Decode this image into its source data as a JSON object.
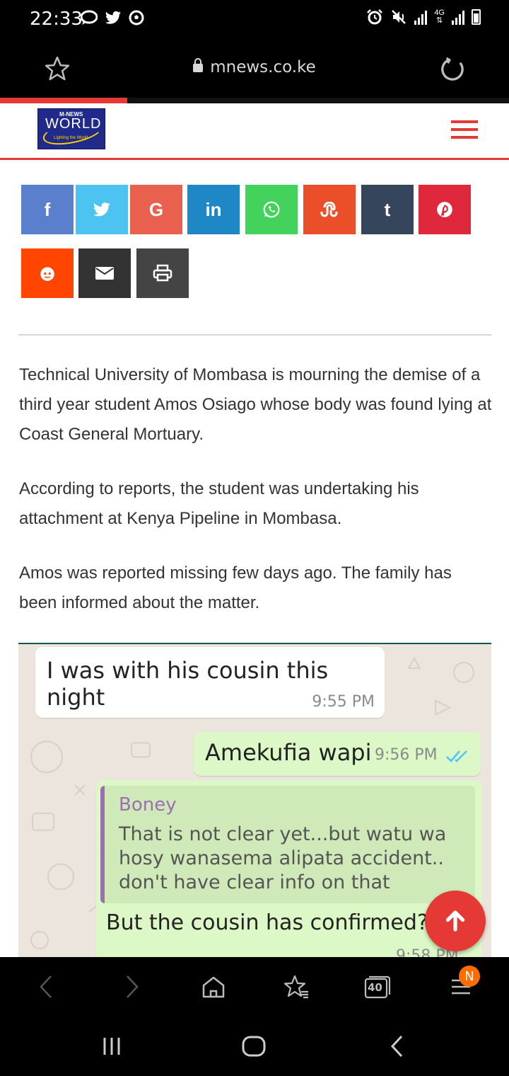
{
  "status_bar": {
    "time": "22:33",
    "left_icons": [
      "chat-bubble-icon",
      "twitter-icon",
      "football-icon"
    ],
    "right_icons": [
      "alarm-icon",
      "mute-icon",
      "signal-icon",
      "lte-4g-icon",
      "signal-icon",
      "battery-icon"
    ],
    "network_label": "4G"
  },
  "browser": {
    "url": "mnews.co.ke",
    "load_progress": 0.25
  },
  "site": {
    "logo_text_top": "M-NEWS",
    "logo_text_main": "WORLD",
    "logo_tagline": "Lighting the World",
    "accent_color": "#e53935"
  },
  "share_buttons": [
    {
      "name": "facebook",
      "glyph": "f",
      "color": "#5a7fcc"
    },
    {
      "name": "twitter",
      "glyph": "",
      "color": "#4cc3f0"
    },
    {
      "name": "google",
      "glyph": "G",
      "color": "#e9614e"
    },
    {
      "name": "linkedin",
      "glyph": "in",
      "color": "#1e88c6"
    },
    {
      "name": "whatsapp",
      "glyph": "",
      "color": "#43d35d"
    },
    {
      "name": "stumbleupon",
      "glyph": "",
      "color": "#ea4f29"
    },
    {
      "name": "tumblr",
      "glyph": "t",
      "color": "#35465c"
    },
    {
      "name": "pinterest",
      "glyph": "",
      "color": "#e0283c"
    },
    {
      "name": "reddit",
      "glyph": "",
      "color": "#ff4500"
    },
    {
      "name": "email",
      "glyph": "",
      "color": "#333333"
    },
    {
      "name": "print",
      "glyph": "",
      "color": "#444444"
    }
  ],
  "article": {
    "paragraphs": [
      "Technical University of Mombasa is mourning the demise of a third year student Amos Osiago whose body was found lying at Coast General Mortuary.",
      "According to reports, the student was undertaking his attachment at Kenya Pipeline in Mombasa.",
      "Amos was reported missing few days ago. The family has been informed about the matter."
    ]
  },
  "chat_image": {
    "messages": [
      {
        "text": "I was with his cousin this night",
        "time": "9:55 PM"
      },
      {
        "text": "Amekufia wapi",
        "time": "9:56 PM"
      },
      {
        "quote_name": "Boney",
        "quote_text": "That is not clear yet...but watu wa hosy wanasema alipata accident.. don't have clear info on that",
        "text": "But the cousin has confirmed?",
        "time": "9:58 PM"
      }
    ]
  },
  "toolbar": {
    "tabs_count": "40",
    "menu_badge": "N"
  }
}
